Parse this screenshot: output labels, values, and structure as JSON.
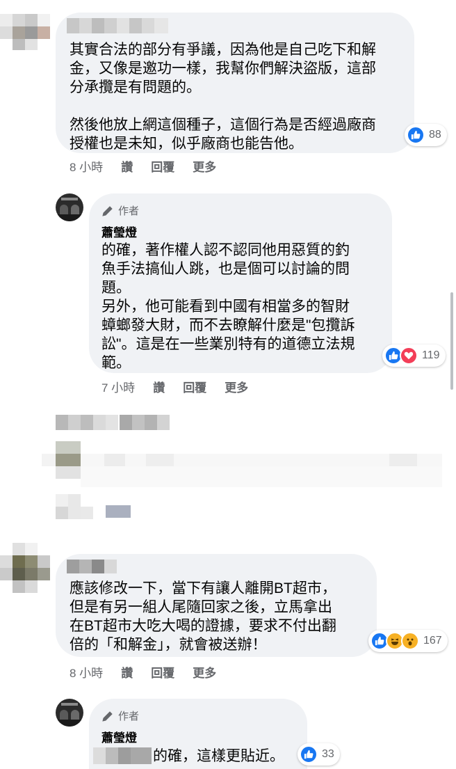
{
  "comments": [
    {
      "text": "其實合法的部分有爭議，因為他是自己吃下和解\n金，又像是邀功一樣，我幫你們解決盜版，這部\n分承攬是有問題的。\n\n然後他放上網這個種子，這個行為是否經過廠商\n授權也是未知，似乎廠商也能告他。",
      "reaction_count": "88",
      "time": "8 小時",
      "read_label": "讚",
      "reply_label": "回覆",
      "more_label": "更多"
    },
    {
      "author_tag": "作者",
      "author_name": "蕭瑩燈",
      "text": "的確，著作權人認不認同他用惡質的釣\n魚手法搞仙人跳，也是個可以討論的問\n題。\n另外，他可能看到中國有相當多的智財\n蟑螂發大財，而不去瞭解什麼是\"包攬訴\n訟\"。這是在一些業別特有的道德立法規\n範。",
      "reaction_count": "119",
      "time": "7 小時",
      "read_label": "讚",
      "reply_label": "回覆",
      "more_label": "更多"
    },
    {
      "text": "應該修改一下，當下有讓人離開BT超市，\n但是有另一組人尾隨回家之後，立馬拿出\n在BT超市大吃大喝的證據，要求不付出翻\n倍的「和解金」，就會被送辦！",
      "reaction_count": "167",
      "time": "8 小時",
      "read_label": "讚",
      "reply_label": "回覆",
      "more_label": "更多"
    },
    {
      "author_tag": "作者",
      "author_name": "蕭瑩燈",
      "text": "的確，這樣更貼近。",
      "reaction_count": "33"
    }
  ],
  "icons": {
    "pencil": "pencil-icon",
    "like": "like-icon",
    "love": "love-icon",
    "haha": "haha-icon",
    "wow": "wow-icon"
  },
  "colors": {
    "bubble": "#f0f2f5",
    "meta": "#65676b",
    "like": "#1877f2",
    "love": "#f33e58",
    "haha": "#f7b125"
  }
}
